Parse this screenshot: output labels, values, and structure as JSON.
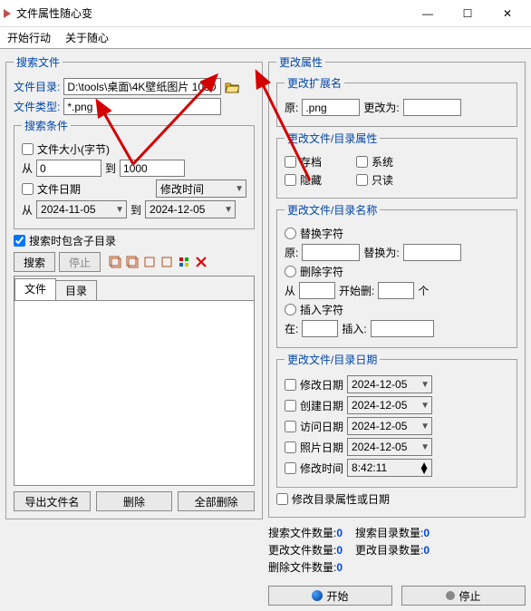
{
  "window": {
    "title": "文件属性随心变"
  },
  "menu": {
    "start": "开始行动",
    "about": "关于随心"
  },
  "search": {
    "group": "搜索文件",
    "dir_label": "文件目录:",
    "dir_value": "D:\\tools\\桌面\\4K壁纸图片 1080",
    "type_label": "文件类型:",
    "type_value": "*.png",
    "cond_group": "搜索条件",
    "size_label": "文件大小(字节)",
    "from": "从",
    "to": "到",
    "size_from": "0",
    "size_to": "1000",
    "date_label": "文件日期",
    "date_kind": "修改时间",
    "date_from": "2024-11-05",
    "date_to": "2024-12-05",
    "subdir": "搜索时包含子目录",
    "btn_search": "搜索",
    "btn_stop": "停止",
    "tab_file": "文件",
    "tab_dir": "目录",
    "export": "导出文件名",
    "delete": "删除",
    "delete_all": "全部删除"
  },
  "change": {
    "group": "更改属性",
    "ext_group": "更改扩展名",
    "orig": "原:",
    "ext_val": ".png",
    "to": "更改为:",
    "attr_group": "更改文件/目录属性",
    "archive": "存档",
    "system": "系统",
    "hidden": "隐藏",
    "readonly": "只读",
    "name_group": "更改文件/目录名称",
    "replace": "替换字符",
    "replace_to": "替换为:",
    "delchar": "删除字符",
    "start_del": "开始删:",
    "unit": "个",
    "insert": "插入字符",
    "at": "在:",
    "ins": "插入:",
    "date_group": "更改文件/目录日期",
    "mod_date": "修改日期",
    "create_date": "创建日期",
    "access_date": "访问日期",
    "photo_date": "照片日期",
    "mod_time": "修改时间",
    "date_val": "2024-12-05",
    "time_val": "8:42:11",
    "dir_attr": "修改目录属性或日期"
  },
  "stats": {
    "search_files": "搜索文件数量:",
    "search_dirs": "搜索目录数量:",
    "change_files": "更改文件数量:",
    "change_dirs": "更改目录数量:",
    "del_files": "删除文件数量:",
    "zero": "0"
  },
  "action": {
    "start": "开始",
    "stop": "停止"
  }
}
